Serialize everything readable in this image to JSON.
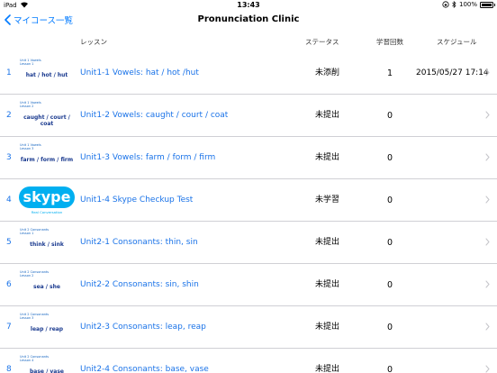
{
  "statusbar": {
    "carrier": "iPad",
    "time": "13:43",
    "battery": "100%",
    "battery_level": 1.0
  },
  "nav": {
    "back_label": "マイコース一覧",
    "title": "Pronunciation Clinic"
  },
  "headers": {
    "lesson": "レッスン",
    "status": "ステータス",
    "count": "学習回数",
    "schedule": "スケジュール"
  },
  "rows": [
    {
      "index": "1",
      "thumb_small": "Unit 1 Vowels\nLesson 1",
      "thumb_words": "hat / hot / hut",
      "title": "Unit1-1 Vowels: hat / hot /hut",
      "status": "未添削",
      "count": "1",
      "date": "2015/05/27 17:14"
    },
    {
      "index": "2",
      "thumb_small": "Unit 1 Vowels\nLesson 2",
      "thumb_words": "caught / court / coat",
      "title": "Unit1-2 Vowels: caught / court / coat",
      "status": "未提出",
      "count": "0",
      "date": ""
    },
    {
      "index": "3",
      "thumb_small": "Unit 1 Vowels\nLesson 3",
      "thumb_words": "farm / form / firm",
      "title": "Unit1-3 Vowels: farm / form / firm",
      "status": "未提出",
      "count": "0",
      "date": ""
    },
    {
      "index": "4",
      "thumb_logo": "skype",
      "thumb_sub": "Real Conversation",
      "title": "Unit1-4 Skype Checkup Test",
      "status": "未学習",
      "count": "0",
      "date": ""
    },
    {
      "index": "5",
      "thumb_small": "Unit 2 Consonants\nLesson 1",
      "thumb_words": "think / sink",
      "title": "Unit2-1 Consonants: thin, sin",
      "status": "未提出",
      "count": "0",
      "date": ""
    },
    {
      "index": "6",
      "thumb_small": "Unit 2 Consonants\nLesson 2",
      "thumb_words": "sea / she",
      "title": "Unit2-2 Consonants: sin, shin",
      "status": "未提出",
      "count": "0",
      "date": ""
    },
    {
      "index": "7",
      "thumb_small": "Unit 2 Consonants\nLesson 3",
      "thumb_words": "leap / reap",
      "title": "Unit2-3 Consonants: leap, reap",
      "status": "未提出",
      "count": "0",
      "date": ""
    },
    {
      "index": "8",
      "thumb_small": "Unit 2 Consonants\nLesson 4",
      "thumb_words": "base / vase",
      "title": "Unit2-4 Consonants: base, vase",
      "status": "未提出",
      "count": "0",
      "date": ""
    }
  ],
  "colors": {
    "accent": "#007aff",
    "link": "#1a73e8",
    "skype": "#00aff0"
  }
}
